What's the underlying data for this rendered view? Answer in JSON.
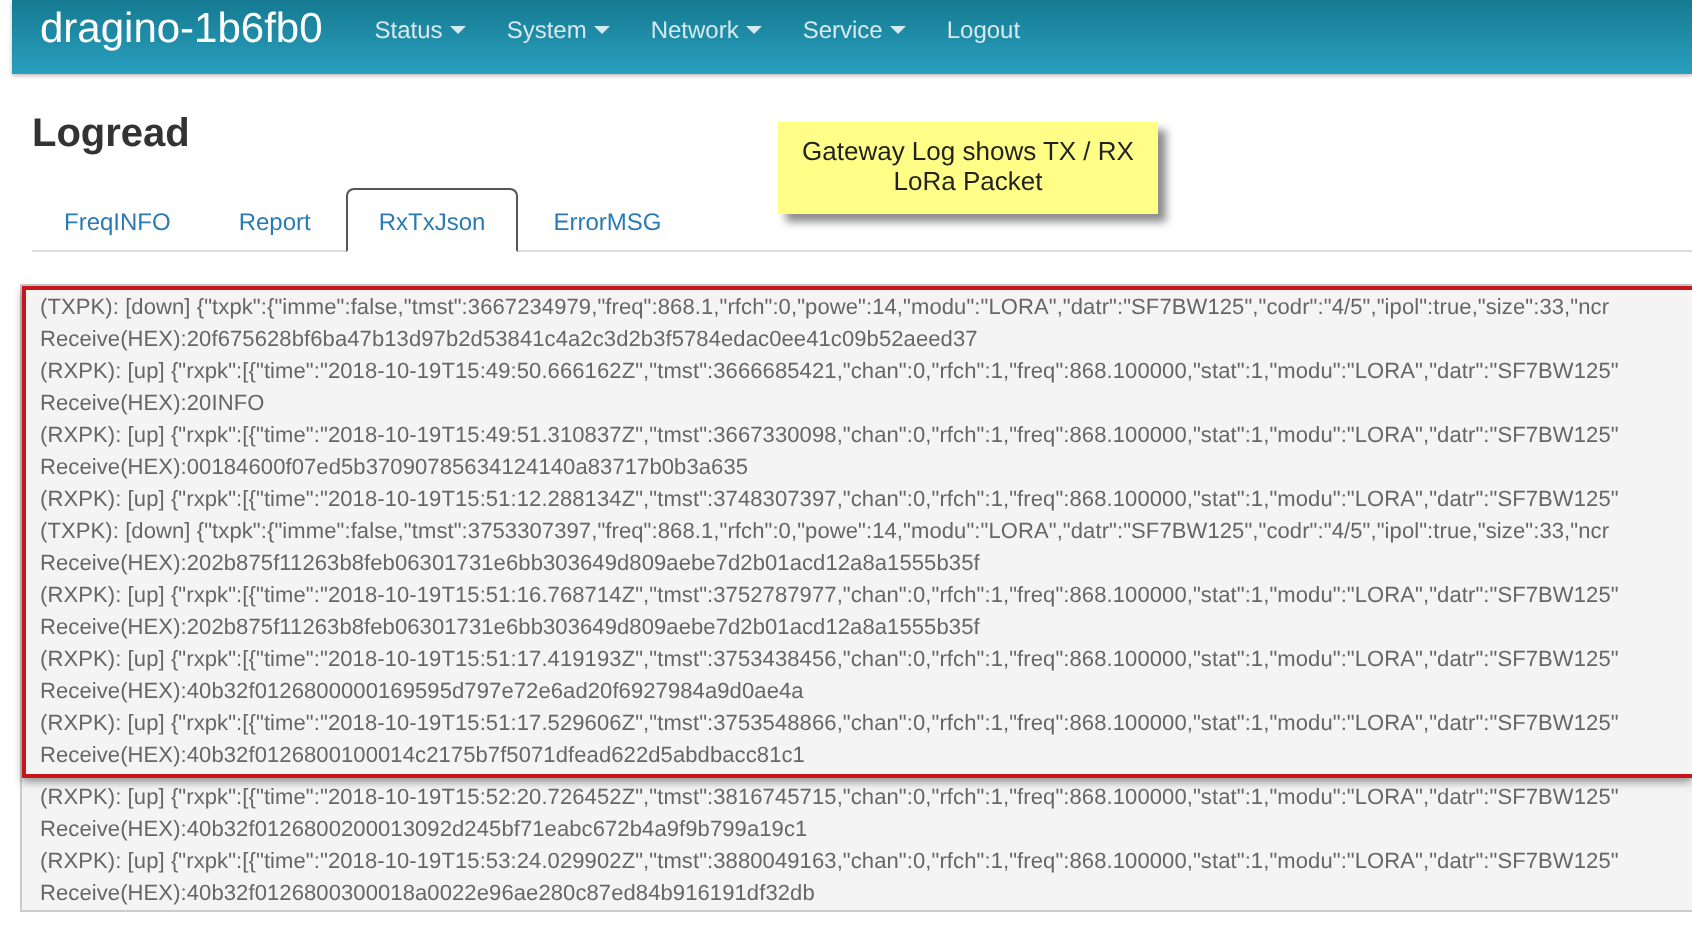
{
  "navbar": {
    "brand": "dragino-1b6fb0",
    "items": [
      {
        "label": "Status",
        "dropdown": true
      },
      {
        "label": "System",
        "dropdown": true
      },
      {
        "label": "Network",
        "dropdown": true
      },
      {
        "label": "Service",
        "dropdown": true
      },
      {
        "label": "Logout",
        "dropdown": false
      }
    ]
  },
  "page": {
    "title": "Logread"
  },
  "note": {
    "lines": [
      "Gateway Log shows TX / RX",
      "LoRa Packet"
    ]
  },
  "tabs": [
    {
      "label": "FreqINFO",
      "selected": false
    },
    {
      "label": "Report",
      "selected": false
    },
    {
      "label": "RxTxJson",
      "selected": true
    },
    {
      "label": "ErrorMSG",
      "selected": false
    }
  ],
  "log": {
    "lines": [
      {
        "text": "(TXPK): [down] {\"txpk\":{\"imme\":false,\"tmst\":3667234979,\"freq\":868.1,\"rfch\":0,\"powe\":14,\"modu\":\"LORA\",\"datr\":\"SF7BW125\",\"codr\":\"4/5\",\"ipol\":true,\"size\":33,\"ncr",
        "highlighted": true
      },
      {
        "text": "Receive(HEX):20f675628bf6ba47b13d97b2d53841c4a2c3d2b3f5784edac0ee41c09b52aeed37",
        "highlighted": true
      },
      {
        "text": "(RXPK): [up] {\"rxpk\":[{\"time\":\"2018-10-19T15:49:50.666162Z\",\"tmst\":3666685421,\"chan\":0,\"rfch\":1,\"freq\":868.100000,\"stat\":1,\"modu\":\"LORA\",\"datr\":\"SF7BW125\"",
        "highlighted": true
      },
      {
        "text": "Receive(HEX):20INFO",
        "highlighted": true
      },
      {
        "text": "(RXPK): [up] {\"rxpk\":[{\"time\":\"2018-10-19T15:49:51.310837Z\",\"tmst\":3667330098,\"chan\":0,\"rfch\":1,\"freq\":868.100000,\"stat\":1,\"modu\":\"LORA\",\"datr\":\"SF7BW125\"",
        "highlighted": true
      },
      {
        "text": "Receive(HEX):00184600f07ed5b37090785634124140a83717b0b3a635",
        "highlighted": true
      },
      {
        "text": "(RXPK): [up] {\"rxpk\":[{\"time\":\"2018-10-19T15:51:12.288134Z\",\"tmst\":3748307397,\"chan\":0,\"rfch\":1,\"freq\":868.100000,\"stat\":1,\"modu\":\"LORA\",\"datr\":\"SF7BW125\"",
        "highlighted": true
      },
      {
        "text": "(TXPK): [down] {\"txpk\":{\"imme\":false,\"tmst\":3753307397,\"freq\":868.1,\"rfch\":0,\"powe\":14,\"modu\":\"LORA\",\"datr\":\"SF7BW125\",\"codr\":\"4/5\",\"ipol\":true,\"size\":33,\"ncr",
        "highlighted": true
      },
      {
        "text": "Receive(HEX):202b875f11263b8feb06301731e6bb303649d809aebe7d2b01acd12a8a1555b35f",
        "highlighted": true
      },
      {
        "text": "(RXPK): [up] {\"rxpk\":[{\"time\":\"2018-10-19T15:51:16.768714Z\",\"tmst\":3752787977,\"chan\":0,\"rfch\":1,\"freq\":868.100000,\"stat\":1,\"modu\":\"LORA\",\"datr\":\"SF7BW125\"",
        "highlighted": true
      },
      {
        "text": "Receive(HEX):202b875f11263b8feb06301731e6bb303649d809aebe7d2b01acd12a8a1555b35f",
        "highlighted": true
      },
      {
        "text": "(RXPK): [up] {\"rxpk\":[{\"time\":\"2018-10-19T15:51:17.419193Z\",\"tmst\":3753438456,\"chan\":0,\"rfch\":1,\"freq\":868.100000,\"stat\":1,\"modu\":\"LORA\",\"datr\":\"SF7BW125\"",
        "highlighted": true
      },
      {
        "text": "Receive(HEX):40b32f0126800000169595d797e72e6ad20f6927984a9d0ae4a",
        "highlighted": true
      },
      {
        "text": "(RXPK): [up] {\"rxpk\":[{\"time\":\"2018-10-19T15:51:17.529606Z\",\"tmst\":3753548866,\"chan\":0,\"rfch\":1,\"freq\":868.100000,\"stat\":1,\"modu\":\"LORA\",\"datr\":\"SF7BW125\"",
        "highlighted": true
      },
      {
        "text": "Receive(HEX):40b32f0126800100014c2175b7f5071dfead622d5abdbacc81c1",
        "highlighted": true
      },
      {
        "text": "(RXPK): [up] {\"rxpk\":[{\"time\":\"2018-10-19T15:52:20.726452Z\",\"tmst\":3816745715,\"chan\":0,\"rfch\":1,\"freq\":868.100000,\"stat\":1,\"modu\":\"LORA\",\"datr\":\"SF7BW125\"",
        "highlighted": false
      },
      {
        "text": "Receive(HEX):40b32f0126800200013092d245bf71eabc672b4a9f9b799a19c1",
        "highlighted": false
      },
      {
        "text": "(RXPK): [up] {\"rxpk\":[{\"time\":\"2018-10-19T15:53:24.029902Z\",\"tmst\":3880049163,\"chan\":0,\"rfch\":1,\"freq\":868.100000,\"stat\":1,\"modu\":\"LORA\",\"datr\":\"SF7BW125\"",
        "highlighted": false
      },
      {
        "text": "Receive(HEX):40b32f0126800300018a0022e96ae280c87ed84b916191df32db",
        "highlighted": false
      }
    ]
  }
}
